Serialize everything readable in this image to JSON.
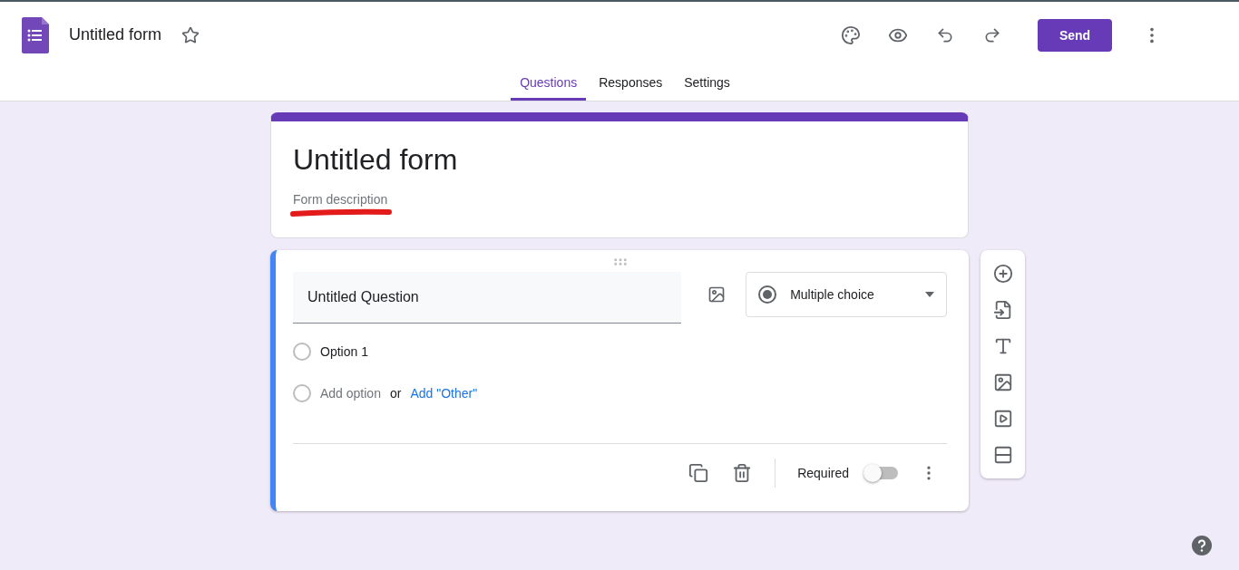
{
  "header": {
    "title": "Untitled form",
    "starred": false,
    "send_label": "Send"
  },
  "tabs": [
    {
      "label": "Questions",
      "selected": true
    },
    {
      "label": "Responses",
      "selected": false
    },
    {
      "label": "Settings",
      "selected": false
    }
  ],
  "form": {
    "title": "Untitled form",
    "description_placeholder": "Form description"
  },
  "question": {
    "title": "Untitled Question",
    "type_label": "Multiple choice",
    "options": [
      {
        "label": "Option 1",
        "checked": false
      }
    ],
    "add_option_checked": false,
    "add_option_placeholder": "Add option",
    "or_text": "or",
    "add_other_label": "Add \"Other\"",
    "required_label": "Required",
    "required": false
  }
}
